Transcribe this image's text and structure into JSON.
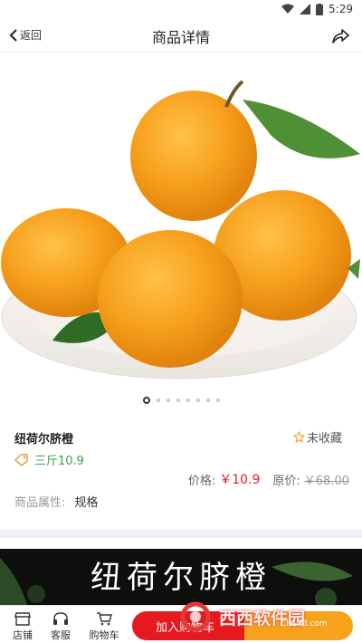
{
  "status": {
    "time": "5:29"
  },
  "nav": {
    "back_label": "返回",
    "title": "商品详情"
  },
  "gallery": {
    "image_count": 8,
    "active_index": 0
  },
  "product": {
    "name": "纽荷尔脐橙",
    "favorite_label": "未收藏",
    "spec_tag": "三斤10.9",
    "price_label": "价格:",
    "price_now": "￥10.9",
    "orig_label": "原价:",
    "price_orig": "￥68.00",
    "attr_key": "商品属性:",
    "attr_val": "规格"
  },
  "banner": {
    "text": "纽荷尔脐橙"
  },
  "tabbar": {
    "shop": "店铺",
    "service": "客服",
    "cart": "购物车",
    "add_to_cart": "加入购物车"
  },
  "watermark": {
    "text": "西西软件园",
    "sub": "CR173.com"
  },
  "colors": {
    "price": "#e02020",
    "add_to_cart": "#e5191e",
    "buy": "#f7a21b",
    "spec": "#3aa14a"
  }
}
